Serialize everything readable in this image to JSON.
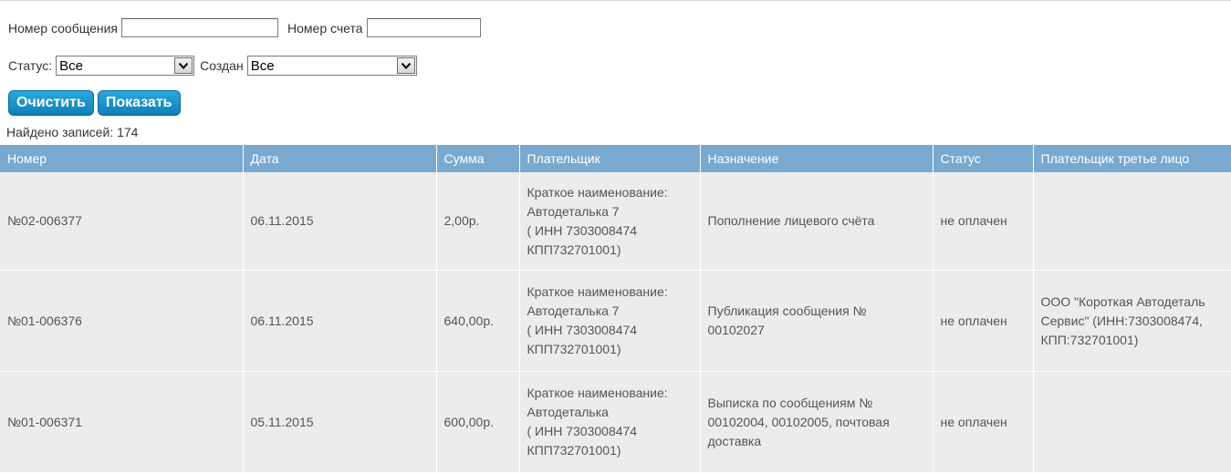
{
  "filters": {
    "message_number_label": "Номер сообщения",
    "message_number_value": "",
    "account_number_label": "Номер счета",
    "account_number_value": "",
    "status_label": "Статус:",
    "status_value": "Все",
    "created_label": "Создан",
    "created_value": "Все"
  },
  "buttons": {
    "clear": "Очистить",
    "show": "Показать"
  },
  "found_text": "Найдено записей: 174",
  "table": {
    "headers": [
      "Номер",
      "Дата",
      "Сумма",
      "Плательщик",
      "Назначение",
      "Статус",
      "Плательщик третье лицо"
    ],
    "rows": [
      {
        "number": "№02-006377",
        "date": "06.11.2015",
        "sum": "2,00р.",
        "payer": [
          "Краткое наименование:",
          "Автодеталька 7",
          "( ИНН 7303008474",
          "КПП732701001)"
        ],
        "purpose": [
          "Пополнение лицевого счёта"
        ],
        "status": "не оплачен",
        "third_party": []
      },
      {
        "number": "№01-006376",
        "date": "06.11.2015",
        "sum": "640,00р.",
        "payer": [
          "Краткое наименование:",
          "Автодеталька 7",
          "( ИНН 7303008474",
          "КПП732701001)"
        ],
        "purpose": [
          "Публикация сообщения №",
          "00102027"
        ],
        "status": "не оплачен",
        "third_party": [
          "ООО \"Короткая Автодеталь",
          "Сервис\" (ИНН:7303008474,",
          "КПП:732701001)"
        ]
      },
      {
        "number": "№01-006371",
        "date": "05.11.2015",
        "sum": "600,00р.",
        "payer": [
          "Краткое наименование:",
          "Автодеталька",
          "( ИНН 7303008474",
          "КПП732701001)"
        ],
        "purpose": [
          "Выписка по сообщениям №",
          "00102004, 00102005, почтовая",
          "доставка"
        ],
        "status": "не оплачен",
        "third_party": []
      }
    ]
  }
}
